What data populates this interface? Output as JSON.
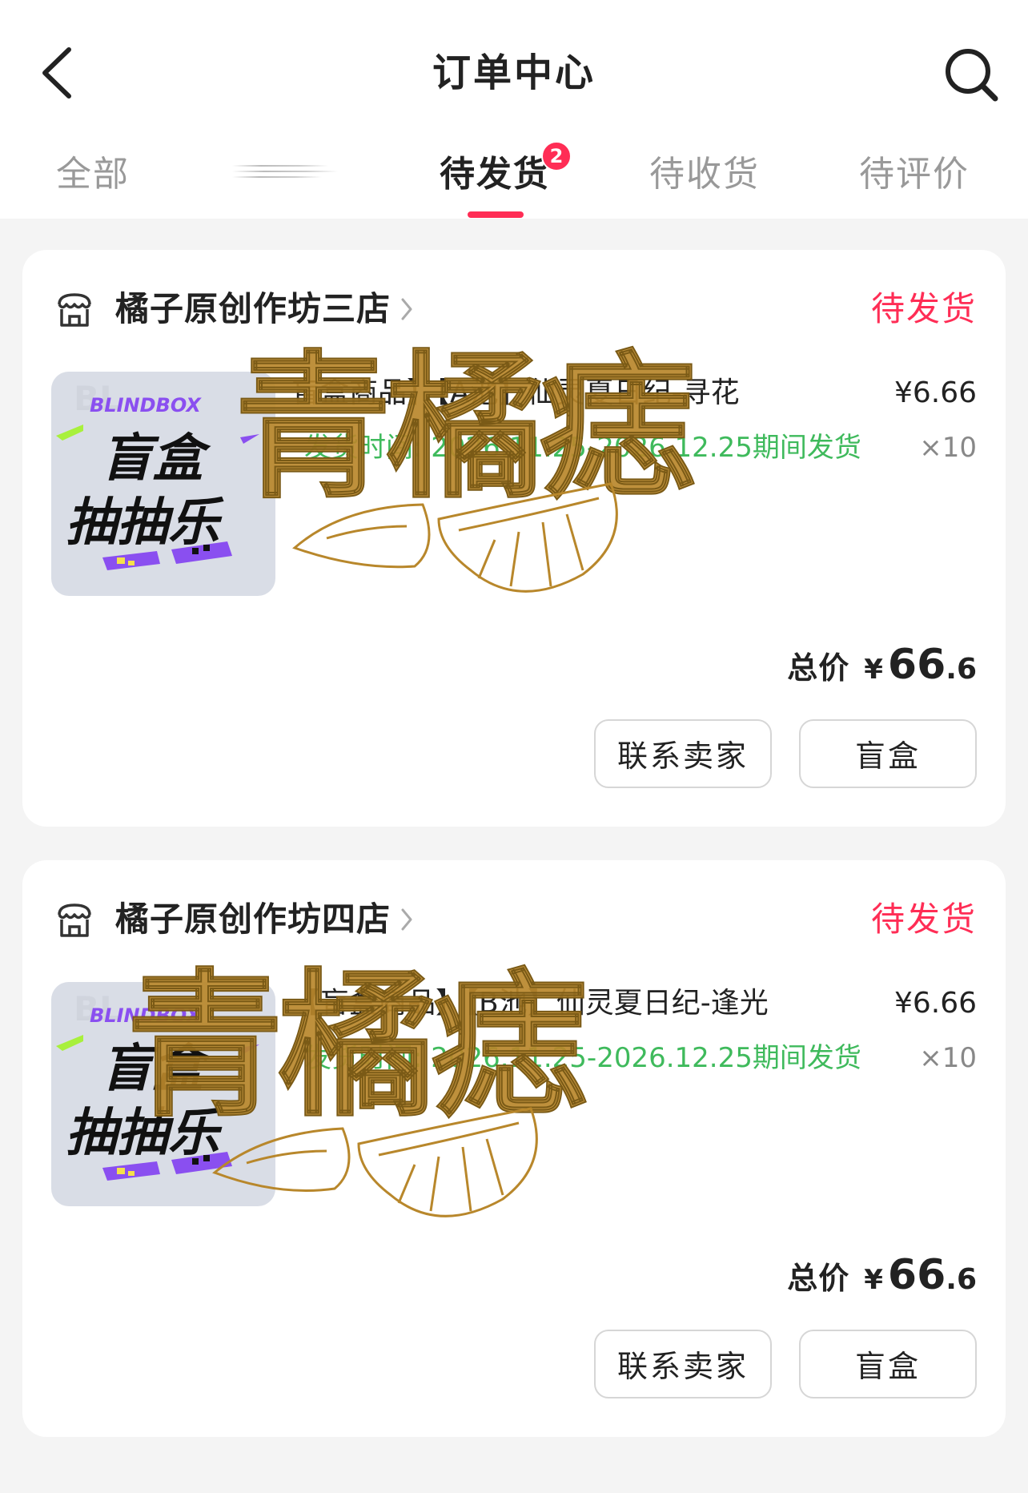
{
  "header": {
    "title": "订单中心"
  },
  "tabs": [
    {
      "label": "全部",
      "active": false
    },
    {
      "label": "",
      "active": false
    },
    {
      "label": "待发货",
      "active": true,
      "badge": "2"
    },
    {
      "label": "待收货",
      "active": false
    },
    {
      "label": "待评价",
      "active": false
    }
  ],
  "orders": [
    {
      "shop_name": "橘子原创作坊三店",
      "status": "待发货",
      "product_title": "盲盒商品】【A池】仙灵夏日纪-寻花",
      "ship_window": "发货时间: 2026.11.25-2026.12.25期间发货",
      "unit_price": "¥6.66",
      "quantity": "×10",
      "total_label": "总价",
      "total_currency": "¥",
      "total_int": "66",
      "total_dec": ".6",
      "buttons": {
        "contact": "联系卖家",
        "blindbox": "盲盒"
      }
    },
    {
      "shop_name": "橘子原创作坊四店",
      "status": "待发货",
      "product_title": "【盲盒商品】【B池】仙灵夏日纪-逢光",
      "ship_window": "发货时间: 2026.11.25-2026.12.25期间发货",
      "unit_price": "¥6.66",
      "quantity": "×10",
      "total_label": "总价",
      "total_currency": "¥",
      "total_int": "66",
      "total_dec": ".6",
      "buttons": {
        "contact": "联系卖家",
        "blindbox": "盲盒"
      }
    }
  ],
  "thumbnail": {
    "brand_text": "BLINDBOX",
    "line1": "盲盒",
    "line2": "抽抽乐"
  },
  "watermark": {
    "text": "青橘痣"
  },
  "colors": {
    "accent": "#ff2d55",
    "ship_green": "#3fba5c",
    "gold": "#b8872b"
  },
  "icons": [
    "back-icon",
    "search-icon",
    "shop-icon",
    "chevron-right-icon",
    "orange-slice-icon"
  ]
}
